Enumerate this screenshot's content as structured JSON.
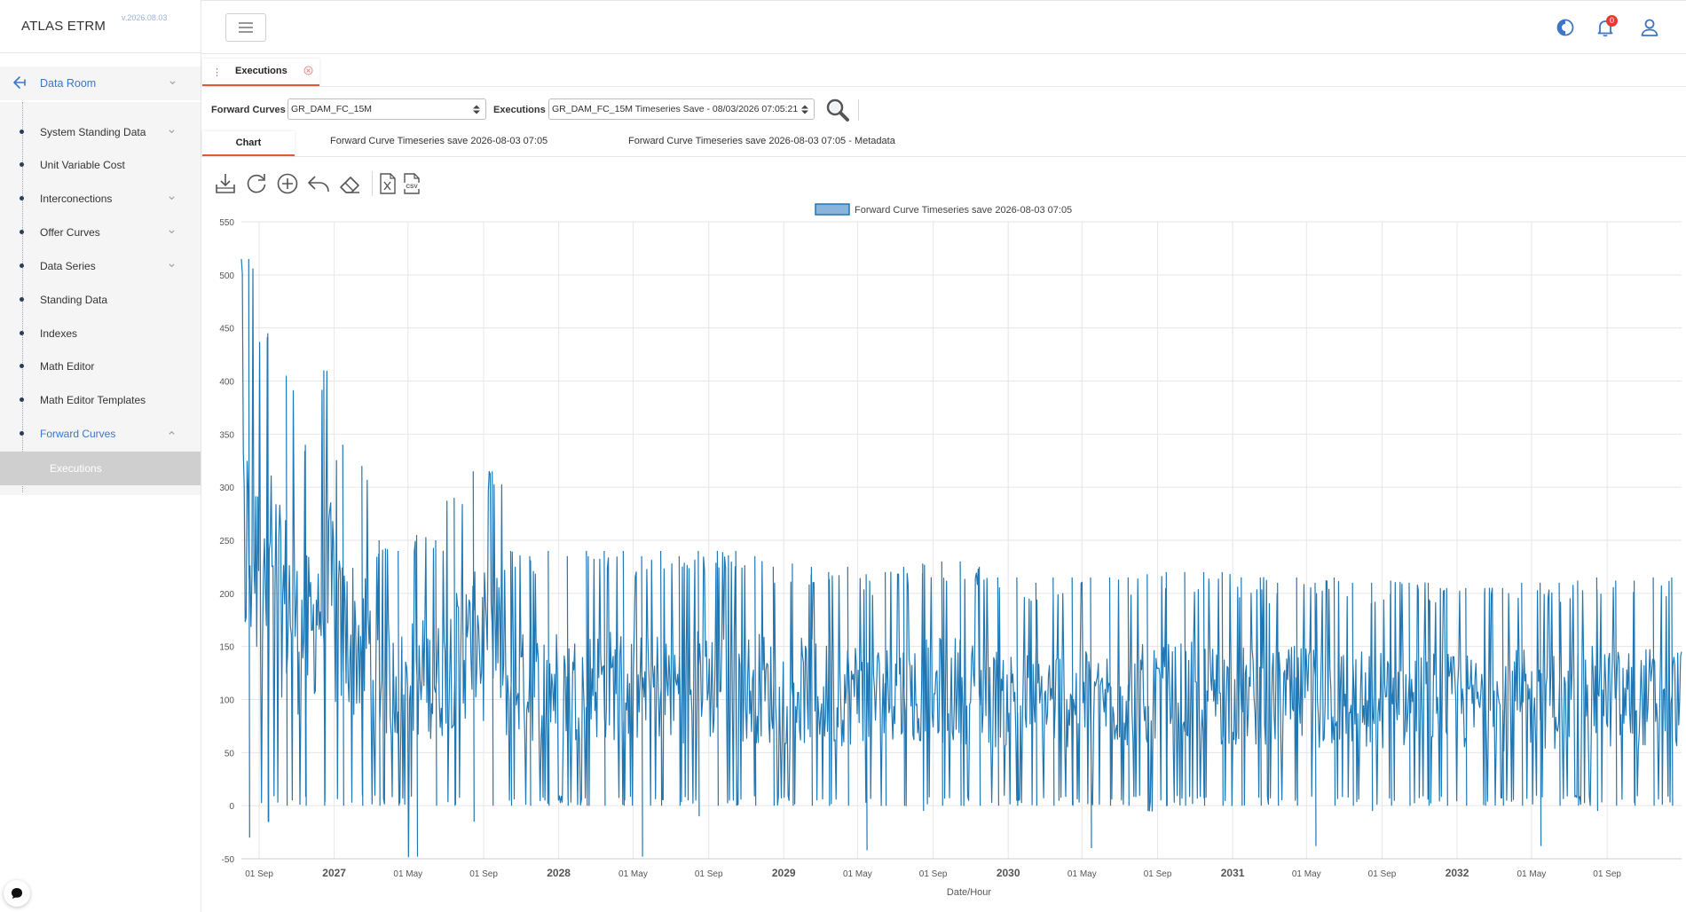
{
  "app": {
    "name": "ATLAS ETRM",
    "version": "v.2026.08.03"
  },
  "sidebar": {
    "root": {
      "label": "Data Room",
      "icon": "back-arrow-icon"
    },
    "items": [
      {
        "label": "System Standing Data",
        "expandable": true
      },
      {
        "label": "Unit Variable Cost",
        "expandable": false
      },
      {
        "label": "Interconections",
        "expandable": true
      },
      {
        "label": "Offer Curves",
        "expandable": true
      },
      {
        "label": "Data Series",
        "expandable": true
      },
      {
        "label": "Standing Data",
        "expandable": false
      },
      {
        "label": "Indexes",
        "expandable": false
      },
      {
        "label": "Math Editor",
        "expandable": false
      },
      {
        "label": "Math Editor Templates",
        "expandable": false
      },
      {
        "label": "Forward Curves",
        "expandable": true,
        "expanded": true,
        "active": true
      }
    ],
    "selected_sub_item": "Executions"
  },
  "header": {
    "icons": [
      "menu-icon",
      "theme-toggle-icon",
      "bell-icon",
      "user-icon"
    ],
    "notification_count": "0"
  },
  "page_tab": {
    "label": "Executions"
  },
  "filters": {
    "forward_curves_label": "Forward Curves",
    "forward_curves_value": "GR_DAM_FC_15M",
    "executions_label": "Executions",
    "executions_value": "GR_DAM_FC_15M Timeseries Save - 08/03/2026 07:05:21"
  },
  "subtabs": [
    {
      "label": "Chart",
      "active": true
    },
    {
      "label": "Forward Curve Timeseries save 2026-08-03 07:05",
      "active": false
    },
    {
      "label": "Forward Curve Timeseries save 2026-08-03 07:05 - Metadata",
      "active": false
    }
  ],
  "toolbar": [
    "download-icon",
    "refresh-icon",
    "zoom-in-icon",
    "undo-icon",
    "eraser-icon",
    "excel-export-icon",
    "csv-export-icon"
  ],
  "colors": {
    "accent": "#3b76c7",
    "series": "#1f77b4",
    "tab_underline": "#e05a3a"
  },
  "chart_data": {
    "type": "line",
    "title": "",
    "legend": {
      "entries": [
        "Forward Curve Timeseries save 2026-08-03 07:05"
      ],
      "position": "top-center"
    },
    "xlabel": "Date/Hour",
    "ylabel": "",
    "x_range": [
      "2026-08-03",
      "2032-12-31"
    ],
    "ylim": [
      -50,
      550
    ],
    "y_ticks": [
      -50,
      0,
      50,
      100,
      150,
      200,
      250,
      300,
      350,
      400,
      450,
      500,
      550
    ],
    "x_ticks": [
      {
        "date": "2026-09-01",
        "label": "01 Sep",
        "major": false
      },
      {
        "date": "2027-01-01",
        "label": "2027",
        "major": true
      },
      {
        "date": "2027-05-01",
        "label": "01 May",
        "major": false
      },
      {
        "date": "2027-09-01",
        "label": "01 Sep",
        "major": false
      },
      {
        "date": "2028-01-01",
        "label": "2028",
        "major": true
      },
      {
        "date": "2028-05-01",
        "label": "01 May",
        "major": false
      },
      {
        "date": "2028-09-01",
        "label": "01 Sep",
        "major": false
      },
      {
        "date": "2029-01-01",
        "label": "2029",
        "major": true
      },
      {
        "date": "2029-05-01",
        "label": "01 May",
        "major": false
      },
      {
        "date": "2029-09-01",
        "label": "01 Sep",
        "major": false
      },
      {
        "date": "2030-01-01",
        "label": "2030",
        "major": true
      },
      {
        "date": "2030-05-01",
        "label": "01 May",
        "major": false
      },
      {
        "date": "2030-09-01",
        "label": "01 Sep",
        "major": false
      },
      {
        "date": "2031-01-01",
        "label": "2031",
        "major": true
      },
      {
        "date": "2031-05-01",
        "label": "01 May",
        "major": false
      },
      {
        "date": "2031-09-01",
        "label": "01 Sep",
        "major": false
      },
      {
        "date": "2032-01-01",
        "label": "2032",
        "major": true
      },
      {
        "date": "2032-05-01",
        "label": "01 May",
        "major": false
      },
      {
        "date": "2032-09-01",
        "label": "01 Sep",
        "major": false
      }
    ],
    "grid": true,
    "series": [
      {
        "name": "Forward Curve Timeseries save 2026-08-03 07:05",
        "envelope_monthly": [
          {
            "month": "2026-08",
            "min": -30,
            "max": 515
          },
          {
            "month": "2026-09",
            "min": -15,
            "max": 445
          },
          {
            "month": "2026-10",
            "min": 0,
            "max": 405
          },
          {
            "month": "2026-11",
            "min": 0,
            "max": 340
          },
          {
            "month": "2026-12",
            "min": 0,
            "max": 410
          },
          {
            "month": "2027-01",
            "min": 0,
            "max": 340
          },
          {
            "month": "2027-02",
            "min": 0,
            "max": 320
          },
          {
            "month": "2027-03",
            "min": 0,
            "max": 250
          },
          {
            "month": "2027-04",
            "min": 0,
            "max": 240
          },
          {
            "month": "2027-05",
            "min": -48,
            "max": 255
          },
          {
            "month": "2027-06",
            "min": 0,
            "max": 250
          },
          {
            "month": "2027-07",
            "min": 0,
            "max": 290
          },
          {
            "month": "2027-08",
            "min": -15,
            "max": 315
          },
          {
            "month": "2027-09",
            "min": 0,
            "max": 315
          },
          {
            "month": "2027-10",
            "min": 0,
            "max": 240
          },
          {
            "month": "2027-11",
            "min": 0,
            "max": 235
          },
          {
            "month": "2027-12",
            "min": 0,
            "max": 240
          },
          {
            "month": "2028-01",
            "min": 0,
            "max": 235
          },
          {
            "month": "2028-02",
            "min": 0,
            "max": 240
          },
          {
            "month": "2028-03",
            "min": 0,
            "max": 240
          },
          {
            "month": "2028-04",
            "min": 0,
            "max": 240
          },
          {
            "month": "2028-05",
            "min": -48,
            "max": 235
          },
          {
            "month": "2028-06",
            "min": 0,
            "max": 240
          },
          {
            "month": "2028-07",
            "min": 0,
            "max": 235
          },
          {
            "month": "2028-08",
            "min": -10,
            "max": 240
          },
          {
            "month": "2028-09",
            "min": 0,
            "max": 240
          },
          {
            "month": "2028-10",
            "min": 0,
            "max": 240
          },
          {
            "month": "2028-11",
            "min": 0,
            "max": 235
          },
          {
            "month": "2028-12",
            "min": 0,
            "max": 225
          },
          {
            "month": "2029-01",
            "min": 0,
            "max": 228
          },
          {
            "month": "2029-02",
            "min": 0,
            "max": 225
          },
          {
            "month": "2029-03",
            "min": 0,
            "max": 220
          },
          {
            "month": "2029-04",
            "min": 0,
            "max": 225
          },
          {
            "month": "2029-05",
            "min": -42,
            "max": 218
          },
          {
            "month": "2029-06",
            "min": 0,
            "max": 220
          },
          {
            "month": "2029-07",
            "min": 0,
            "max": 225
          },
          {
            "month": "2029-08",
            "min": -5,
            "max": 228
          },
          {
            "month": "2029-09",
            "min": 0,
            "max": 230
          },
          {
            "month": "2029-10",
            "min": 0,
            "max": 230
          },
          {
            "month": "2029-11",
            "min": 0,
            "max": 225
          },
          {
            "month": "2029-12",
            "min": 0,
            "max": 215
          },
          {
            "month": "2030-01",
            "min": 0,
            "max": 215
          },
          {
            "month": "2030-02",
            "min": 0,
            "max": 210
          },
          {
            "month": "2030-03",
            "min": 0,
            "max": 215
          },
          {
            "month": "2030-04",
            "min": 0,
            "max": 215
          },
          {
            "month": "2030-05",
            "min": -40,
            "max": 215
          },
          {
            "month": "2030-06",
            "min": 0,
            "max": 215
          },
          {
            "month": "2030-07",
            "min": 0,
            "max": 215
          },
          {
            "month": "2030-08",
            "min": -5,
            "max": 218
          },
          {
            "month": "2030-09",
            "min": 0,
            "max": 220
          },
          {
            "month": "2030-10",
            "min": 0,
            "max": 220
          },
          {
            "month": "2030-11",
            "min": 0,
            "max": 220
          },
          {
            "month": "2030-12",
            "min": 0,
            "max": 220
          },
          {
            "month": "2031-01",
            "min": 0,
            "max": 215
          },
          {
            "month": "2031-02",
            "min": 0,
            "max": 215
          },
          {
            "month": "2031-03",
            "min": 0,
            "max": 210
          },
          {
            "month": "2031-04",
            "min": 0,
            "max": 215
          },
          {
            "month": "2031-05",
            "min": -38,
            "max": 210
          },
          {
            "month": "2031-06",
            "min": 0,
            "max": 215
          },
          {
            "month": "2031-07",
            "min": 0,
            "max": 210
          },
          {
            "month": "2031-08",
            "min": -5,
            "max": 210
          },
          {
            "month": "2031-09",
            "min": 0,
            "max": 212
          },
          {
            "month": "2031-10",
            "min": 0,
            "max": 210
          },
          {
            "month": "2031-11",
            "min": 0,
            "max": 210
          },
          {
            "month": "2031-12",
            "min": 0,
            "max": 205
          },
          {
            "month": "2032-01",
            "min": 0,
            "max": 205
          },
          {
            "month": "2032-02",
            "min": 0,
            "max": 205
          },
          {
            "month": "2032-03",
            "min": 0,
            "max": 205
          },
          {
            "month": "2032-04",
            "min": 0,
            "max": 210
          },
          {
            "month": "2032-05",
            "min": -38,
            "max": 210
          },
          {
            "month": "2032-06",
            "min": 0,
            "max": 210
          },
          {
            "month": "2032-07",
            "min": 0,
            "max": 212
          },
          {
            "month": "2032-08",
            "min": -5,
            "max": 215
          },
          {
            "month": "2032-09",
            "min": 0,
            "max": 212
          },
          {
            "month": "2032-10",
            "min": 0,
            "max": 212
          },
          {
            "month": "2032-11",
            "min": 0,
            "max": 215
          },
          {
            "month": "2032-12",
            "min": 0,
            "max": 215
          }
        ]
      }
    ]
  }
}
